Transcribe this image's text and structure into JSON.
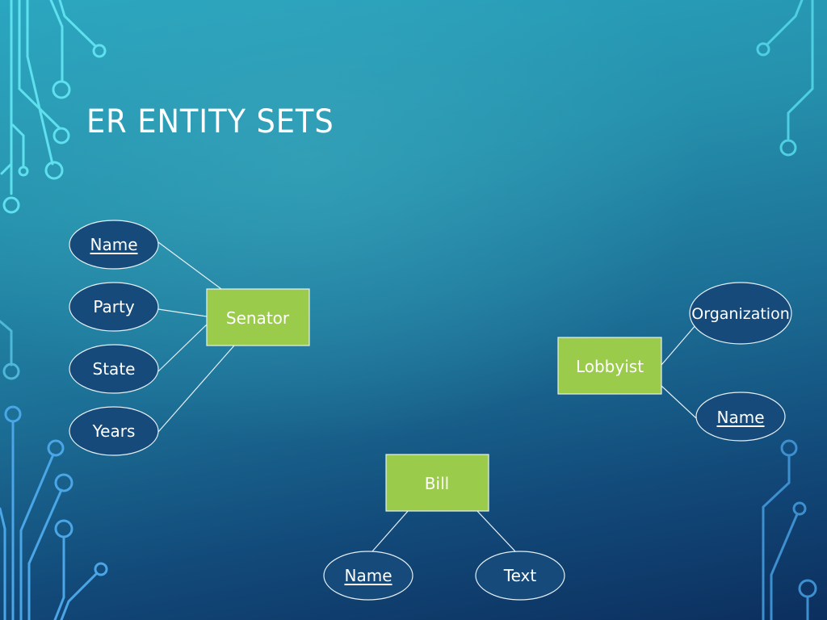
{
  "slide": {
    "title": "ER ENTITY SETS"
  },
  "colors": {
    "entity_fill": "#9bcb4a",
    "attribute_fill": "#154a7a",
    "outline": "#e6f0f5",
    "connector": "#e6f0f5",
    "circuit_top": "#5ee0ee",
    "circuit_bottom": "#4aa6e6"
  },
  "diagram": {
    "entities": [
      {
        "name": "Senator",
        "attributes": [
          {
            "name": "Name",
            "key": true
          },
          {
            "name": "Party",
            "key": false
          },
          {
            "name": "State",
            "key": false
          },
          {
            "name": "Years",
            "key": false
          }
        ]
      },
      {
        "name": "Lobbyist",
        "attributes": [
          {
            "name": "Organization",
            "key": false
          },
          {
            "name": "Name",
            "key": true
          }
        ]
      },
      {
        "name": "Bill",
        "attributes": [
          {
            "name": "Name",
            "key": true
          },
          {
            "name": "Text",
            "key": false
          }
        ]
      }
    ]
  }
}
